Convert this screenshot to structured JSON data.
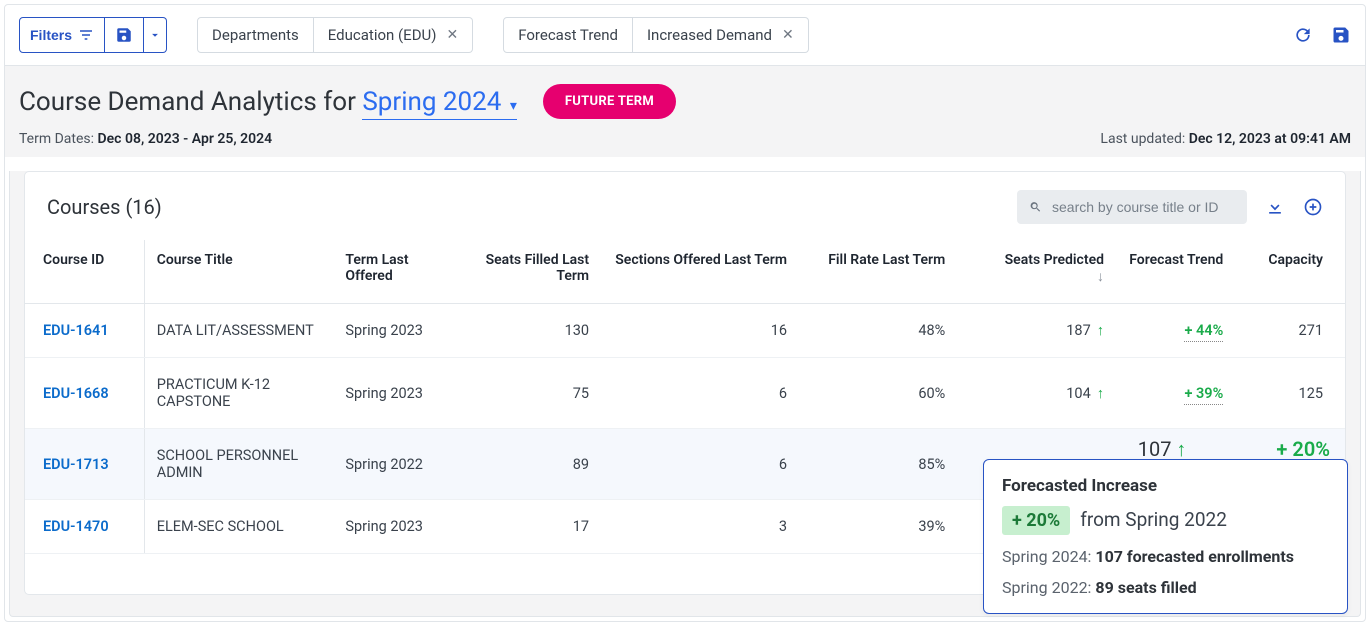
{
  "toolbar": {
    "filters_label": "Filters",
    "tags": [
      {
        "label": "Departments",
        "closable": false
      },
      {
        "label": "Education (EDU)",
        "closable": true
      },
      {
        "label": "Forecast Trend",
        "closable": false
      },
      {
        "label": "Increased Demand",
        "closable": true
      }
    ]
  },
  "header": {
    "title_prefix": "Course Demand Analytics for ",
    "term": "Spring 2024",
    "badge": "FUTURE TERM",
    "term_dates_label": "Term Dates:",
    "term_dates": "Dec 08, 2023 - Apr 25, 2024",
    "updated_label": "Last updated:",
    "updated": "Dec 12, 2023 at 09:41 AM"
  },
  "card": {
    "title": "Courses (16)",
    "search_placeholder": "search by course title or ID"
  },
  "columns": {
    "id": "Course ID",
    "title": "Course Title",
    "term_last": "Term Last Offered",
    "seats_last": "Seats Filled Last Term",
    "sections_last": "Sections Offered Last Term",
    "fill_rate": "Fill Rate Last Term",
    "seats_pred": "Seats Predicted",
    "trend": "Forecast Trend",
    "capacity": "Capacity"
  },
  "rows": [
    {
      "id": "EDU-1641",
      "title": "DATA LIT/ASSESSMENT",
      "term": "Spring 2023",
      "seats_last": "130",
      "sections": "16",
      "fill": "48%",
      "seats_pred": "187",
      "trend": "+ 44%",
      "capacity": "271"
    },
    {
      "id": "EDU-1668",
      "title": "PRACTICUM K-12 CAPSTONE",
      "term": "Spring 2023",
      "seats_last": "75",
      "sections": "6",
      "fill": "60%",
      "seats_pred": "104",
      "trend": "+ 39%",
      "capacity": "125"
    },
    {
      "id": "EDU-1713",
      "title": "SCHOOL PERSONNEL ADMIN",
      "term": "Spring 2022",
      "seats_last": "89",
      "sections": "6",
      "fill": "85%",
      "seats_pred": "",
      "trend": "",
      "capacity": ""
    },
    {
      "id": "EDU-1470",
      "title": "ELEM-SEC SCHOOL",
      "term": "Spring 2023",
      "seats_last": "17",
      "sections": "3",
      "fill": "39%",
      "seats_pred": "",
      "trend": "",
      "capacity": ""
    }
  ],
  "float": {
    "seats": "107",
    "trend": "+ 20%"
  },
  "tooltip": {
    "title": "Forecasted Increase",
    "badge": "+ 20%",
    "from": "from Spring 2022",
    "line1_label": "Spring 2024: ",
    "line1_value": "107 forecasted enrollments",
    "line2_label": "Spring 2022: ",
    "line2_value": "89 seats filled"
  }
}
